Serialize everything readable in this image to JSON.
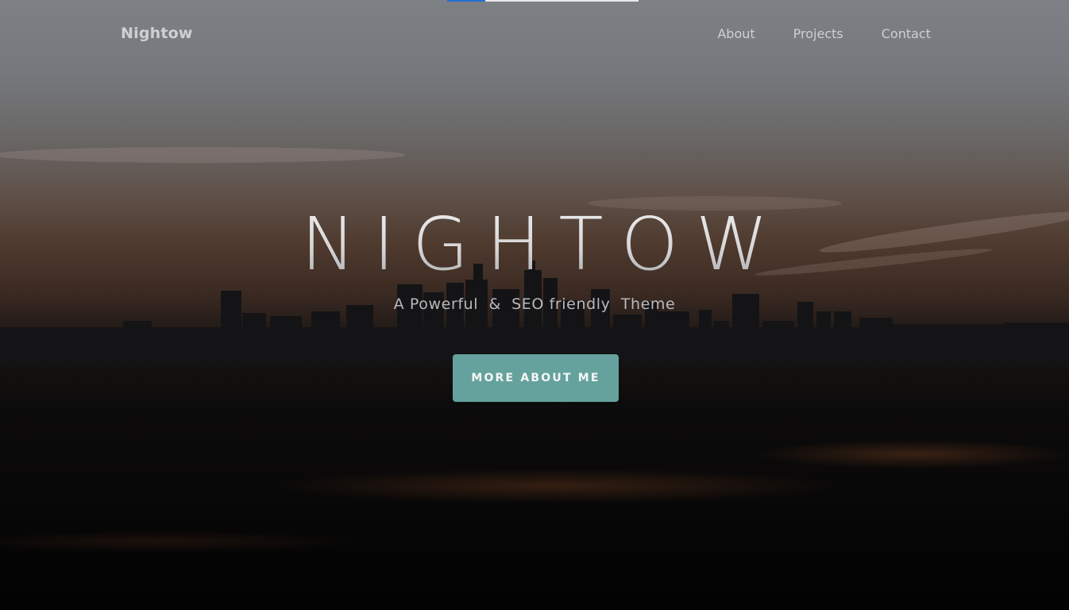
{
  "loader": {
    "progress": 0.2
  },
  "header": {
    "brand": "Nightow",
    "nav": [
      {
        "label": "About"
      },
      {
        "label": "Projects"
      },
      {
        "label": "Contact"
      }
    ]
  },
  "hero": {
    "title": "NIGHTOW",
    "subtitle": "A Powerful  &  SEO friendly  Theme",
    "cta_label": "MORE ABOUT ME",
    "accent_color": "#66a29d"
  }
}
